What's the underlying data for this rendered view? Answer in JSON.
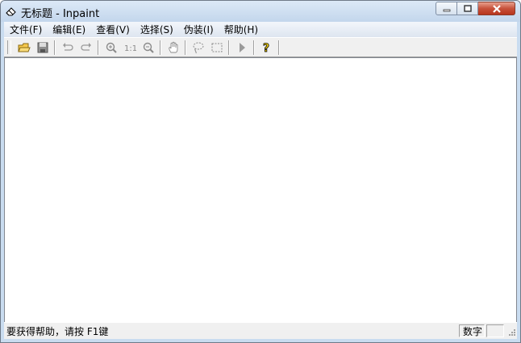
{
  "window": {
    "title": "无标题 - Inpaint"
  },
  "menu": [
    {
      "label": "文件(F)",
      "name": "menu-file"
    },
    {
      "label": "编辑(E)",
      "name": "menu-edit"
    },
    {
      "label": "查看(V)",
      "name": "menu-view"
    },
    {
      "label": "选择(S)",
      "name": "menu-select"
    },
    {
      "label": "伪装(I)",
      "name": "menu-disguise"
    },
    {
      "label": "帮助(H)",
      "name": "menu-help"
    }
  ],
  "toolbar": {
    "icons": [
      "open-icon",
      "save-icon",
      "undo-icon",
      "redo-icon",
      "zoom-in-icon",
      "actual-size-icon",
      "zoom-out-icon",
      "hand-icon",
      "lasso-icon",
      "rect-select-icon",
      "run-icon",
      "help-icon"
    ]
  },
  "status": {
    "text": "要获得帮助，请按 F1键",
    "num_lock": "数字"
  }
}
